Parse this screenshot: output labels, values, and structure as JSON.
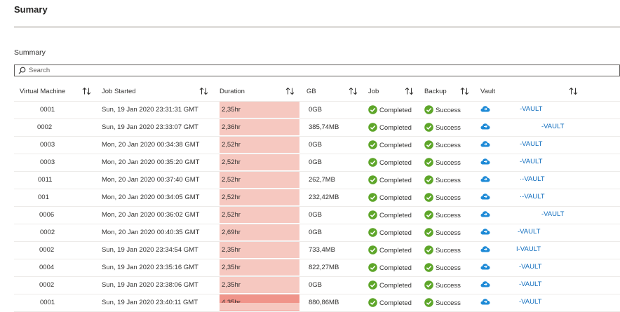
{
  "page": {
    "title": "Sumary"
  },
  "summary": {
    "label": "Summary"
  },
  "search": {
    "placeholder": "Search",
    "value": ""
  },
  "table": {
    "columns": [
      {
        "key": "vm",
        "label": "Virtual Machine"
      },
      {
        "key": "started",
        "label": "Job Started"
      },
      {
        "key": "duration",
        "label": "Duration"
      },
      {
        "key": "gb",
        "label": "GB"
      },
      {
        "key": "job",
        "label": "Job"
      },
      {
        "key": "backup",
        "label": "Backup"
      },
      {
        "key": "vault",
        "label": "Vault"
      }
    ],
    "rows": [
      {
        "vm": "0001",
        "started": "Sun, 19 Jan 2020 23:31:31 GMT",
        "duration": "2,35hr",
        "gb": "0GB",
        "job": "Completed",
        "backup": "Success",
        "vault": "-VAULT"
      },
      {
        "vm": "0002",
        "started": "Sun, 19 Jan 2020 23:33:07 GMT",
        "duration": "2,36hr",
        "gb": "385,74MB",
        "job": "Completed",
        "backup": "Success",
        "vault": "-VAULT"
      },
      {
        "vm": "0003",
        "started": "Mon, 20 Jan 2020 00:34:38 GMT",
        "duration": "2,52hr",
        "gb": "0GB",
        "job": "Completed",
        "backup": "Success",
        "vault": "-VAULT"
      },
      {
        "vm": "0003",
        "started": "Mon, 20 Jan 2020 00:35:20 GMT",
        "duration": "2,52hr",
        "gb": "0GB",
        "job": "Completed",
        "backup": "Success",
        "vault": "-VAULT"
      },
      {
        "vm": "0011",
        "started": "Mon, 20 Jan 2020 00:37:40 GMT",
        "duration": "2,52hr",
        "gb": "262,7MB",
        "job": "Completed",
        "backup": "Success",
        "vault": "·-VAULT"
      },
      {
        "vm": "001",
        "started": "Mon, 20 Jan 2020 00:34:05 GMT",
        "duration": "2,52hr",
        "gb": "232,42MB",
        "job": "Completed",
        "backup": "Success",
        "vault": "·-VAULT"
      },
      {
        "vm": "0006",
        "started": "Mon, 20 Jan 2020 00:36:02 GMT",
        "duration": "2,52hr",
        "gb": "0GB",
        "job": "Completed",
        "backup": "Success",
        "vault": "-VAULT"
      },
      {
        "vm": "0002",
        "started": "Mon, 20 Jan 2020 00:40:35 GMT",
        "duration": "2,69hr",
        "gb": "0GB",
        "job": "Completed",
        "backup": "Success",
        "vault": "-VAULT"
      },
      {
        "vm": "0002",
        "started": "Sun, 19 Jan 2020 23:34:54 GMT",
        "duration": "2,35hr",
        "gb": "733,4MB",
        "job": "Completed",
        "backup": "Success",
        "vault": "I-VAULT"
      },
      {
        "vm": "0004",
        "started": "Sun, 19 Jan 2020 23:35:16 GMT",
        "duration": "2,35hr",
        "gb": "822,27MB",
        "job": "Completed",
        "backup": "Success",
        "vault": "-VAULT"
      },
      {
        "vm": "0002",
        "started": "Sun, 19 Jan 2020 23:38:06 GMT",
        "duration": "2,35hr",
        "gb": "0GB",
        "job": "Completed",
        "backup": "Success",
        "vault": "-VAULT"
      },
      {
        "vm": "0001",
        "started": "Sun, 19 Jan 2020 23:40:11 GMT",
        "duration": "4,35hr",
        "gb": "880,86MB",
        "job": "Completed",
        "backup": "Success",
        "vault": "-VAULT"
      }
    ]
  },
  "colors": {
    "duration_fill": "#f6c8c0",
    "duration_fill_high": "#f0948a",
    "success_green": "#5ea62a",
    "link_blue": "#0f6cbd",
    "cloud_blue": "#1e8ad6"
  },
  "icons": {
    "search": "search-icon",
    "sort": "sort-arrows-icon",
    "status": "check-circle-icon",
    "vault": "recovery-vault-cloud-icon"
  }
}
